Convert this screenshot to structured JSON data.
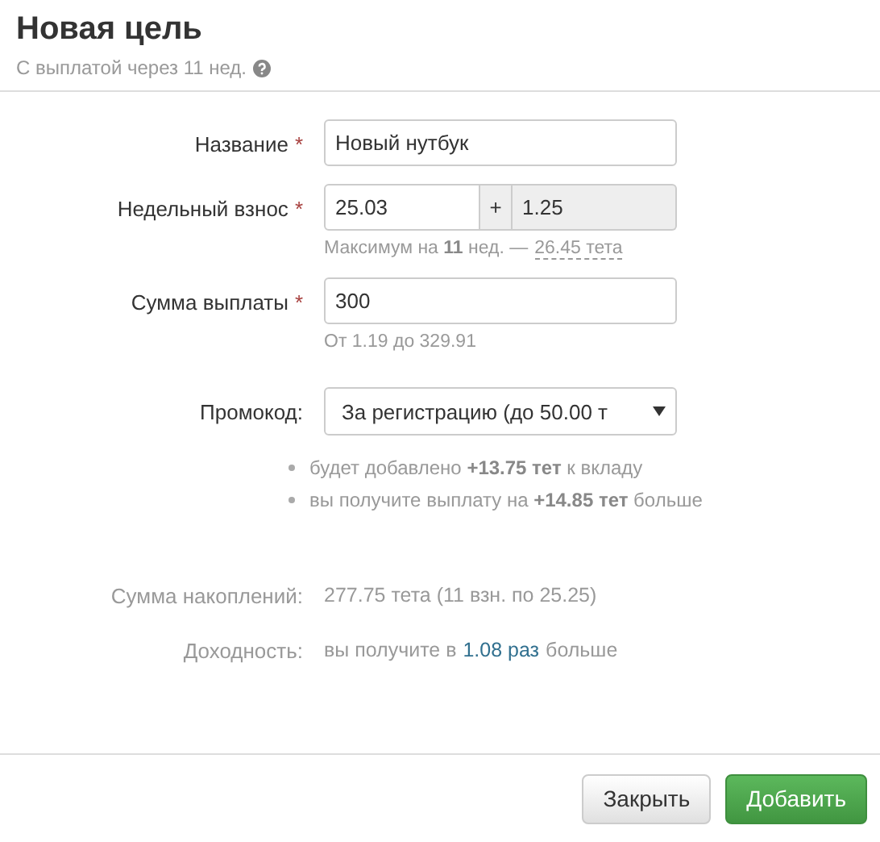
{
  "title": "Новая цель",
  "subtitle": "С выплатой через 11 нед.",
  "fields": [
    {
      "kind": "text",
      "label": "Название",
      "mark": "*",
      "value": "Новый нутбук"
    },
    {
      "kind": "pair",
      "label": "Недельный взнос",
      "mark": "*",
      "value": "25.03",
      "addon": "+",
      "extra": "1.25",
      "hint": "Максимум на **11** нед. —",
      "hint_link": "26.45 тета"
    },
    {
      "kind": "text",
      "label": "Сумма выплаты",
      "mark": "*",
      "value": "300",
      "hint": "От 1.19 до 329.91"
    },
    {
      "kind": "select",
      "label": "Промокод:",
      "value": "За регистрацию (до 50.00 т",
      "bullets": [
        "будет добавлено **+13.75 тет** к вкладу",
        "вы получите выплату на **+14.85 тет** больше"
      ]
    }
  ],
  "summary": [
    {
      "label": "Сумма накоплений:",
      "text": "277.75 тета (11 взн. по 25.25)"
    },
    {
      "label": "Доходность:",
      "text": "вы получите в",
      "highlight": "1.08 раз",
      "suffix": "больше"
    }
  ],
  "buttons": [
    {
      "label": "Закрыть",
      "kind": "default"
    },
    {
      "label": "Добавить",
      "kind": "primary"
    }
  ]
}
